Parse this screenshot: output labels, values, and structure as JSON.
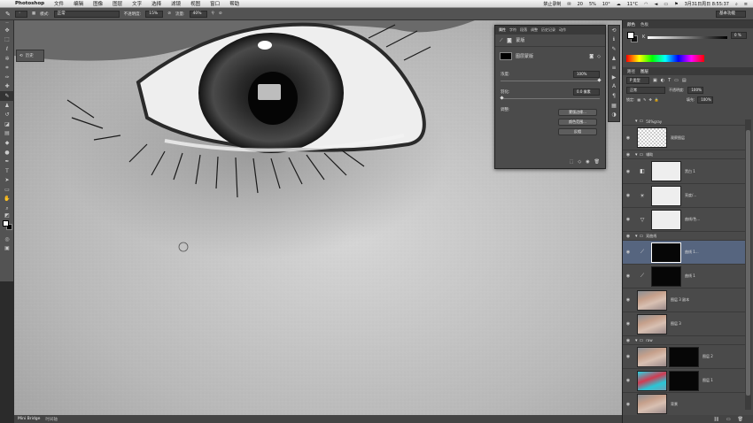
{
  "menubar": {
    "apple": "",
    "app": "Photoshop",
    "items": [
      "文件",
      "编辑",
      "图像",
      "图层",
      "文字",
      "选择",
      "滤镜",
      "视图",
      "窗口",
      "帮助"
    ],
    "status": [
      "禁止录制",
      "20",
      "5%",
      "10°",
      "11°C"
    ],
    "datetime": "3月31日周日 8:55:37"
  },
  "options": {
    "mode_label": "模式:",
    "mode_value": "正常",
    "opacity_label": "不透明度:",
    "opacity_value": "15%",
    "flow_label": "流量:",
    "flow_value": "40%",
    "workspace": "基本功能"
  },
  "history_chip": {
    "label": "历史"
  },
  "properties": {
    "tabs": [
      "属性",
      "字符",
      "段落",
      "调整",
      "历史记录",
      "动作"
    ],
    "title": "蒙版",
    "mask_type": "图层蒙版",
    "density_label": "浓度:",
    "density_value": "100%",
    "density_pct": 100,
    "feather_label": "羽化:",
    "feather_value": "0.0 像素",
    "feather_pct": 0,
    "refine_label": "调整:",
    "btn_edge": "蒙版边缘...",
    "btn_color": "颜色范围...",
    "btn_invert": "反相"
  },
  "colorpanel": {
    "tabs": [
      "颜色",
      "色板"
    ],
    "k_label": "K",
    "k_value": "0 %"
  },
  "layerspanel": {
    "tabs": [
      "路径",
      "图层"
    ],
    "kind_label": "P 类型",
    "blend_mode": "正常",
    "opacity_label": "不透明度:",
    "opacity_value": "100%",
    "lock_label": "锁定:",
    "fill_label": "填充:",
    "fill_value": "100%",
    "layers": [
      {
        "type": "group",
        "name": "50%gray"
      },
      {
        "type": "layer",
        "name": "观察图层",
        "thumb": "transparent"
      },
      {
        "type": "group",
        "name": "辅助"
      },
      {
        "type": "adj",
        "name": "黑白 1",
        "icon": "◧",
        "thumb": "white"
      },
      {
        "type": "adj",
        "name": "亮度/...",
        "icon": "☀",
        "thumb": "white"
      },
      {
        "type": "adj",
        "name": "曲线/色...",
        "icon": "▽",
        "thumb": "white"
      },
      {
        "type": "group",
        "name": "双曲线"
      },
      {
        "type": "adj",
        "name": "曲线 1...",
        "icon": "⟋",
        "thumb": "black",
        "selected": true
      },
      {
        "type": "adj",
        "name": "曲线 1",
        "icon": "⟋",
        "thumb": "black"
      },
      {
        "type": "layer",
        "name": "图层 3 副本",
        "thumb": "photo"
      },
      {
        "type": "layer",
        "name": "图层 3",
        "thumb": "photo"
      },
      {
        "type": "group",
        "name": "raw"
      },
      {
        "type": "layer",
        "name": "图层 2",
        "thumb": "photo",
        "mask": "black"
      },
      {
        "type": "layer",
        "name": "图层 1",
        "thumb": "cyan",
        "mask": "black"
      },
      {
        "type": "layer",
        "name": "背景",
        "thumb": "photo"
      }
    ]
  },
  "statusbar": {
    "tabs": [
      "Mini Bridge",
      "时间轴"
    ]
  },
  "colors": {
    "accent_selected": "#56657f",
    "chrome": "#535353"
  }
}
